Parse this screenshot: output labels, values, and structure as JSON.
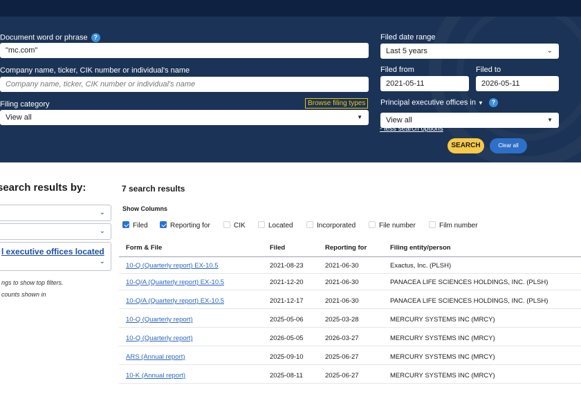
{
  "search": {
    "doc_label": "Document word or phrase",
    "doc_value": "\"mc.com\"",
    "company_label": "Company name, ticker, CIK number or individual's name",
    "company_placeholder": "Company name, ticker, CIK number or individual's name",
    "category_label": "Filing category",
    "category_value": "View all",
    "browse_label": "Browse filing types",
    "date_range_label": "Filed date range",
    "date_range_value": "Last 5 years",
    "from_label": "Filed from",
    "from_value": "2021-05-11",
    "to_label": "Filed to",
    "to_value": "2026-05-11",
    "offices_label": "Principal executive offices in",
    "offices_value": "View all",
    "less_options_label": "- less search options",
    "search_button": "SEARCH",
    "clear_button": "Clear all",
    "help_glyph": "?"
  },
  "sidebar": {
    "title": "search results by:",
    "facet_link": "l executive offices located",
    "note_line1": "ngs to show top filters.",
    "note_line2": "counts shown in"
  },
  "results": {
    "count_label": "7 search results",
    "show_columns_label": "Show Columns",
    "columns": [
      {
        "label": "Filed",
        "checked": true
      },
      {
        "label": "Reporting for",
        "checked": true
      },
      {
        "label": "CIK",
        "checked": false
      },
      {
        "label": "Located",
        "checked": false
      },
      {
        "label": "Incorporated",
        "checked": false
      },
      {
        "label": "File number",
        "checked": false
      },
      {
        "label": "Film number",
        "checked": false
      }
    ],
    "headers": {
      "form": "Form & File",
      "filed": "Filed",
      "reporting": "Reporting for",
      "entity": "Filing entity/person"
    },
    "rows": [
      {
        "form": "10-Q (Quarterly report) EX-10.5",
        "filed": "2021-08-23",
        "reporting": "2021-06-30",
        "entity": "Exactus, Inc. (PLSH)"
      },
      {
        "form": "10-Q/A (Quarterly report) EX-10.5",
        "filed": "2021-12-20",
        "reporting": "2021-06-30",
        "entity": "PANACEA LIFE SCIENCES HOLDINGS, INC. (PLSH)"
      },
      {
        "form": "10-Q/A (Quarterly report) EX-10.5",
        "filed": "2021-12-17",
        "reporting": "2021-06-30",
        "entity": "PANACEA LIFE SCIENCES HOLDINGS, INC. (PLSH)"
      },
      {
        "form": "10-Q (Quarterly report)",
        "filed": "2025-05-06",
        "reporting": "2025-03-28",
        "entity": "MERCURY SYSTEMS INC (MRCY)"
      },
      {
        "form": "10-Q (Quarterly report)",
        "filed": "2026-05-05",
        "reporting": "2026-03-27",
        "entity": "MERCURY SYSTEMS INC (MRCY)"
      },
      {
        "form": "ARS (Annual report)",
        "filed": "2025-09-10",
        "reporting": "2025-06-27",
        "entity": "MERCURY SYSTEMS INC (MRCY)"
      },
      {
        "form": "10-K (Annual report)",
        "filed": "2025-08-11",
        "reporting": "2025-06-27",
        "entity": "MERCURY SYSTEMS INC (MRCY)"
      }
    ]
  },
  "icons": {
    "chevron_down": "chevron-down-icon",
    "dropdown_caret": "caret-down-icon",
    "help": "help-icon",
    "checkbox": "checkbox-icon"
  },
  "colors": {
    "panel": "#1b3356",
    "top_band": "#0f2140",
    "search_button": "#f7c948",
    "clear_button": "#2e6fc7",
    "link": "#2b66c2",
    "checkbox_on": "#2673d6"
  }
}
